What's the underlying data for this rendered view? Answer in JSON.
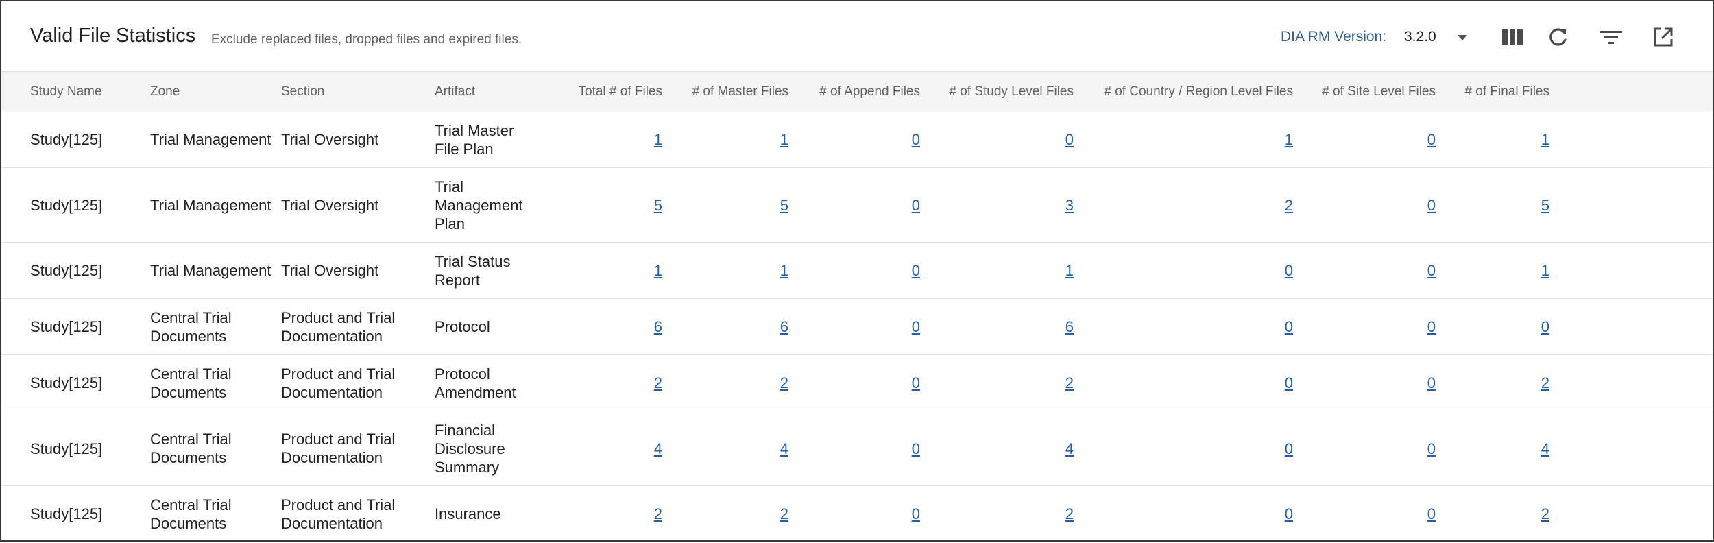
{
  "header": {
    "title": "Valid File Statistics",
    "subtitle": "Exclude replaced files, dropped files and expired files.",
    "version_label": "DIA RM Version:",
    "version_value": "3.2.0",
    "icons": [
      "view-columns-icon",
      "refresh-icon",
      "filter-icon",
      "open-external-icon"
    ]
  },
  "colors": {
    "accent": "#2f5e8e",
    "link": "#1f5fa8",
    "header_bg": "#f5f5f5",
    "border": "#e0e0e0"
  },
  "table": {
    "columns": [
      "Study Name",
      "Zone",
      "Section",
      "Artifact",
      "Total # of Files",
      "# of Master Files",
      "# of Append Files",
      "# of Study Level Files",
      "# of Country / Region Level Files",
      "# of Site Level Files",
      "# of Final Files"
    ],
    "rows": [
      {
        "study": "Study[125]",
        "zone": "Trial Management",
        "section": "Trial Oversight",
        "artifact": "Trial Master File Plan",
        "total": "1",
        "master": "1",
        "append": "0",
        "study_level": "0",
        "country_level": "1",
        "site_level": "0",
        "final": "1"
      },
      {
        "study": "Study[125]",
        "zone": "Trial Management",
        "section": "Trial Oversight",
        "artifact": "Trial Management Plan",
        "total": "5",
        "master": "5",
        "append": "0",
        "study_level": "3",
        "country_level": "2",
        "site_level": "0",
        "final": "5"
      },
      {
        "study": "Study[125]",
        "zone": "Trial Management",
        "section": "Trial Oversight",
        "artifact": "Trial Status Report",
        "total": "1",
        "master": "1",
        "append": "0",
        "study_level": "1",
        "country_level": "0",
        "site_level": "0",
        "final": "1"
      },
      {
        "study": "Study[125]",
        "zone": "Central Trial Documents",
        "section": "Product and Trial Documentation",
        "artifact": "Protocol",
        "total": "6",
        "master": "6",
        "append": "0",
        "study_level": "6",
        "country_level": "0",
        "site_level": "0",
        "final": "0"
      },
      {
        "study": "Study[125]",
        "zone": "Central Trial Documents",
        "section": "Product and Trial Documentation",
        "artifact": "Protocol Amendment",
        "total": "2",
        "master": "2",
        "append": "0",
        "study_level": "2",
        "country_level": "0",
        "site_level": "0",
        "final": "2"
      },
      {
        "study": "Study[125]",
        "zone": "Central Trial Documents",
        "section": "Product and Trial Documentation",
        "artifact": "Financial Disclosure Summary",
        "total": "4",
        "master": "4",
        "append": "0",
        "study_level": "4",
        "country_level": "0",
        "site_level": "0",
        "final": "4"
      },
      {
        "study": "Study[125]",
        "zone": "Central Trial Documents",
        "section": "Product and Trial Documentation",
        "artifact": "Insurance",
        "total": "2",
        "master": "2",
        "append": "0",
        "study_level": "2",
        "country_level": "0",
        "site_level": "0",
        "final": "2"
      }
    ]
  }
}
